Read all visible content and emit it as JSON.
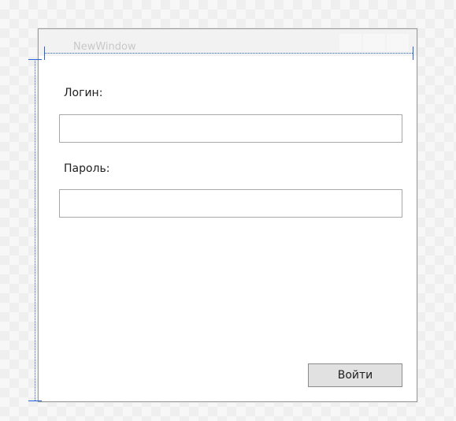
{
  "window": {
    "title": "NewWindow"
  },
  "form": {
    "login_label": "Логин:",
    "login_value": "",
    "password_label": "Пароль:",
    "password_value": "",
    "submit_label": "Войти"
  },
  "colors": {
    "guide": "#2a62d9",
    "button_bg": "#e1e1e1",
    "border": "#a8a8a8"
  }
}
